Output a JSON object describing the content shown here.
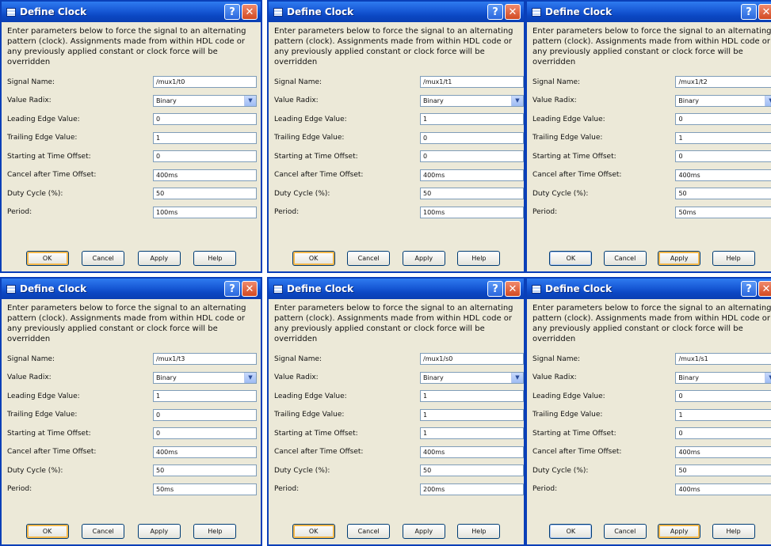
{
  "labels": {
    "title": "Define Clock",
    "description": "Enter parameters below to force the signal to an alternating pattern (clock). Assignments made from within HDL code or any previously applied constant or clock force will be overridden",
    "signal_name": "Signal Name:",
    "value_radix": "Value Radix:",
    "leading_edge": "Leading Edge Value:",
    "trailing_edge": "Trailing Edge Value:",
    "start_offset": "Starting at Time Offset:",
    "cancel_offset": "Cancel after Time Offset:",
    "duty_cycle": "Duty Cycle (%):",
    "period": "Period:",
    "ok": "OK",
    "cancel": "Cancel",
    "apply": "Apply",
    "help": "Help",
    "help_glyph": "?",
    "close_glyph": "✕",
    "dropdown_glyph": "▼"
  },
  "colors": {
    "titlebar": "#0b47c3",
    "dialog_bg": "#ece9d8",
    "border": "#0a3fb8",
    "close_button": "#d24a22",
    "focus_ring": "#f5b84b"
  },
  "dialogs": [
    {
      "signal_name": "/mux1/t0",
      "value_radix": "Binary",
      "leading_edge": "0",
      "trailing_edge": "1",
      "start_offset": "0",
      "cancel_offset": "400ms",
      "duty_cycle": "50",
      "period": "100ms",
      "focused_button": "ok"
    },
    {
      "signal_name": "/mux1/t1",
      "value_radix": "Binary",
      "leading_edge": "1",
      "trailing_edge": "0",
      "start_offset": "0",
      "cancel_offset": "400ms",
      "duty_cycle": "50",
      "period": "100ms",
      "focused_button": "ok"
    },
    {
      "signal_name": "/mux1/t2",
      "value_radix": "Binary",
      "leading_edge": "0",
      "trailing_edge": "1",
      "start_offset": "0",
      "cancel_offset": "400ms",
      "duty_cycle": "50",
      "period": "50ms",
      "focused_button": "apply"
    },
    {
      "signal_name": "/mux1/t3",
      "value_radix": "Binary",
      "leading_edge": "1",
      "trailing_edge": "0",
      "start_offset": "0",
      "cancel_offset": "400ms",
      "duty_cycle": "50",
      "period": "50ms",
      "focused_button": "ok"
    },
    {
      "signal_name": "/mux1/s0",
      "value_radix": "Binary",
      "leading_edge": "1",
      "trailing_edge": "1",
      "start_offset": "1",
      "cancel_offset": "400ms",
      "duty_cycle": "50",
      "period": "200ms",
      "focused_button": "ok"
    },
    {
      "signal_name": "/mux1/s1",
      "value_radix": "Binary",
      "leading_edge": "0",
      "trailing_edge": "1",
      "start_offset": "0",
      "cancel_offset": "400ms",
      "duty_cycle": "50",
      "period": "400ms",
      "focused_button": "apply"
    }
  ]
}
